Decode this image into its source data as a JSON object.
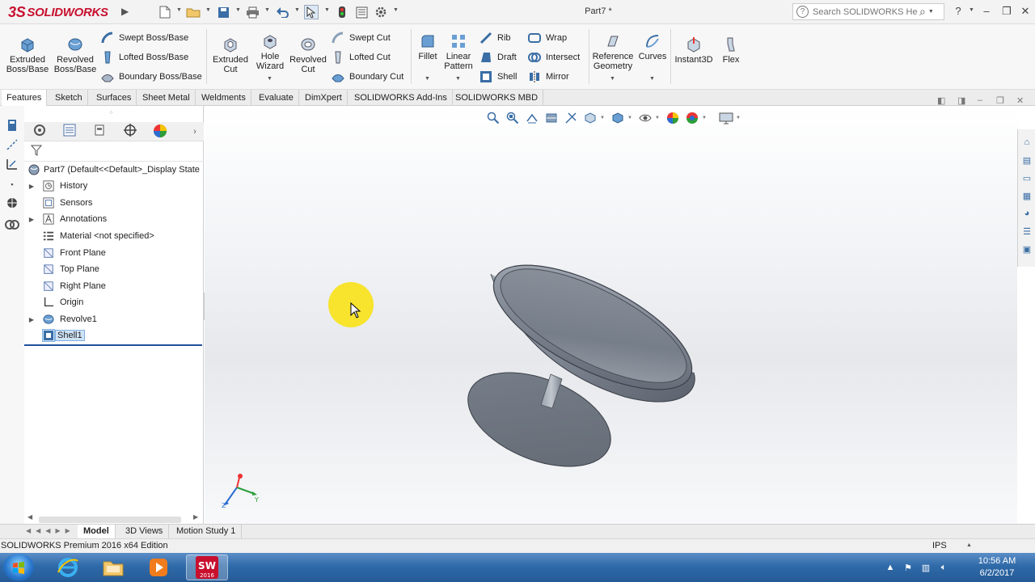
{
  "app": {
    "brand": "SOLIDWORKS",
    "brand_mark": "3S",
    "doc_title": "Part7 *",
    "search_placeholder": "Search SOLIDWORKS Help",
    "help_glyph": "?"
  },
  "commands": {
    "extruded_boss": "Extruded Boss/Base",
    "revolved_boss": "Revolved Boss/Base",
    "swept_boss": "Swept Boss/Base",
    "lofted_boss": "Lofted Boss/Base",
    "boundary_boss": "Boundary Boss/Base",
    "extruded_cut": "Extruded Cut",
    "hole_wizard": "Hole Wizard",
    "revolved_cut": "Revolved Cut",
    "swept_cut": "Swept Cut",
    "lofted_cut": "Lofted Cut",
    "boundary_cut": "Boundary Cut",
    "fillet": "Fillet",
    "linear_pattern": "Linear Pattern",
    "rib": "Rib",
    "draft": "Draft",
    "shell": "Shell",
    "wrap": "Wrap",
    "intersect": "Intersect",
    "mirror": "Mirror",
    "reference_geometry": "Reference Geometry",
    "curves": "Curves",
    "instant3d": "Instant3D",
    "flex": "Flex"
  },
  "tabs": [
    "Features",
    "Sketch",
    "Surfaces",
    "Sheet Metal",
    "Weldments",
    "Evaluate",
    "DimXpert",
    "SOLIDWORKS Add-Ins",
    "SOLIDWORKS MBD"
  ],
  "tree": {
    "root": "Part7  (Default<<Default>_Display State",
    "items": [
      {
        "label": "History",
        "expandable": true
      },
      {
        "label": "Sensors",
        "expandable": false
      },
      {
        "label": "Annotations",
        "expandable": true
      },
      {
        "label": "Material <not specified>",
        "expandable": false
      },
      {
        "label": "Front Plane",
        "expandable": false
      },
      {
        "label": "Top Plane",
        "expandable": false
      },
      {
        "label": "Right Plane",
        "expandable": false
      },
      {
        "label": "Origin",
        "expandable": false
      },
      {
        "label": "Revolve1",
        "expandable": true
      },
      {
        "label": "Shell1",
        "expandable": false,
        "selected": true
      }
    ]
  },
  "bottom_tabs": [
    "Model",
    "3D Views",
    "Motion Study 1"
  ],
  "status": {
    "text": "SOLIDWORKS Premium 2016 x64 Edition",
    "units": "IPS"
  },
  "taskbar": {
    "sw_badge": "2016",
    "time": "10:56 AM",
    "date": "6/2/2017"
  },
  "colors": {
    "brand_red": "#c8102e",
    "part_gray": "#808893",
    "selection_blue": "#1f4e9e",
    "cursor_highlight": "#f8e21c"
  }
}
